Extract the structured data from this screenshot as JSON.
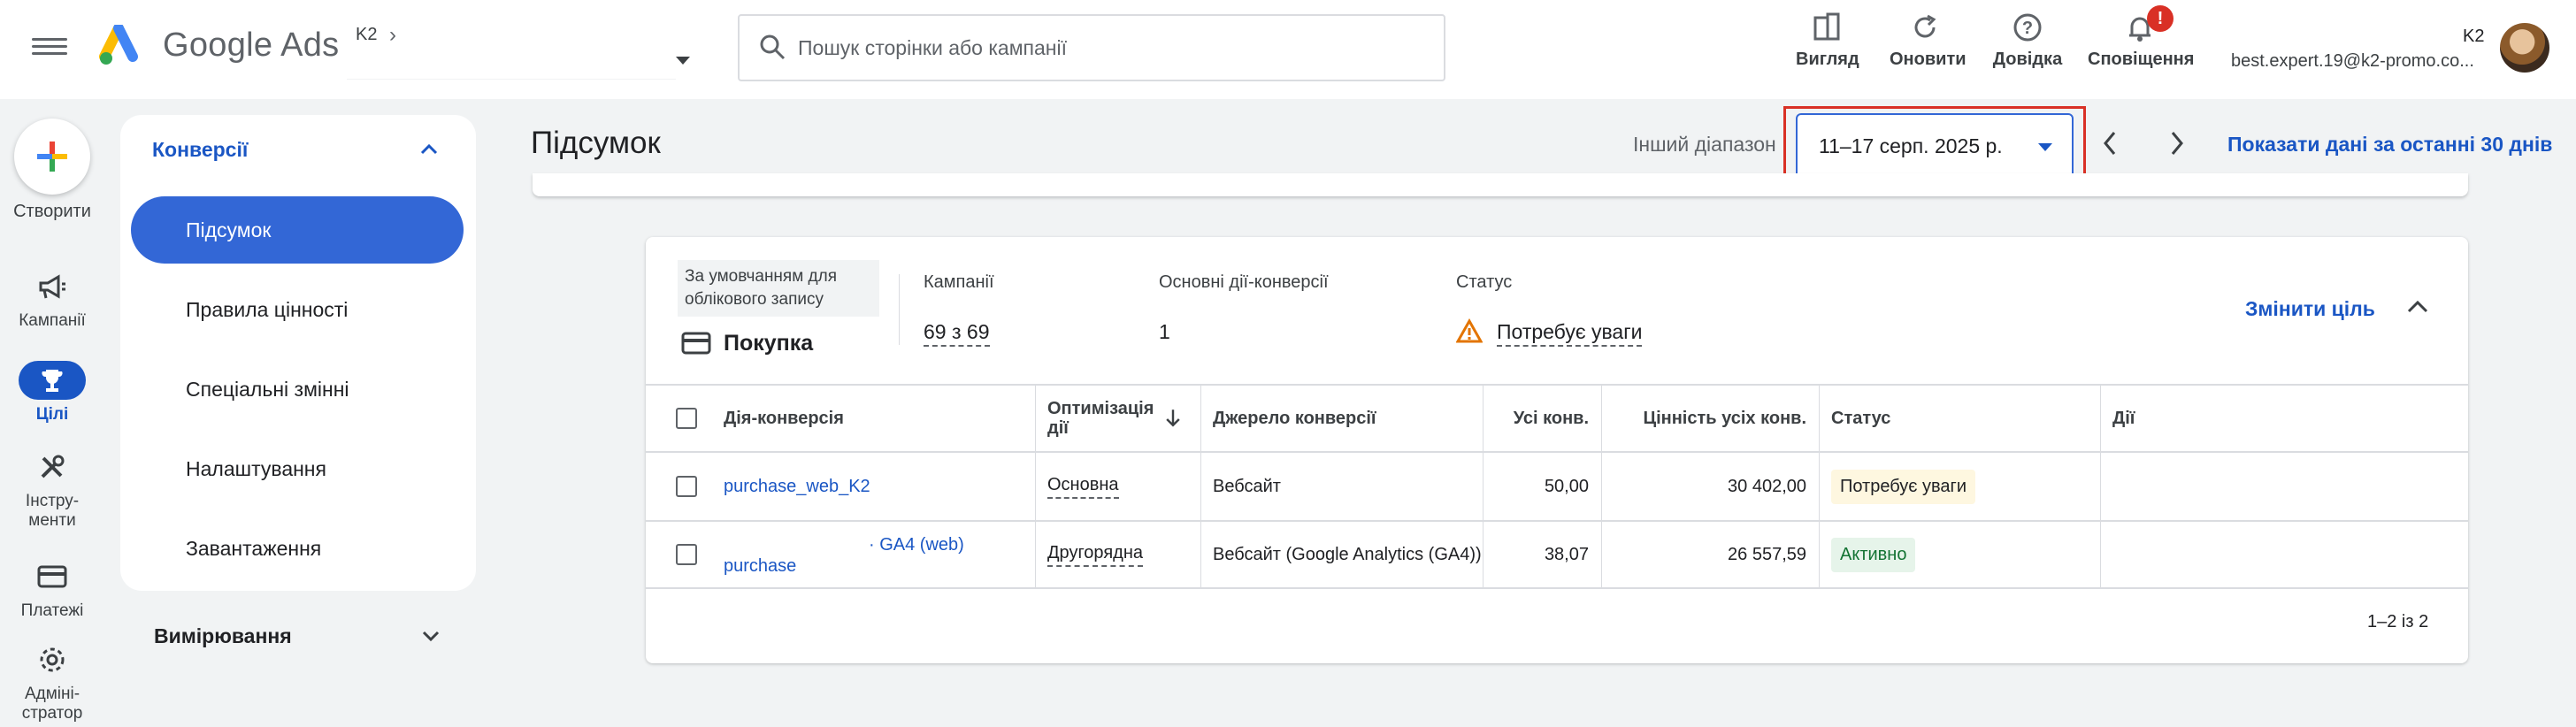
{
  "header": {
    "brand": "Google Ads",
    "account_name": "K2",
    "search_placeholder": "Пошук сторінки або кампанії",
    "buttons": {
      "view": "Вигляд",
      "refresh": "Оновити",
      "help": "Довідка",
      "notifications": "Сповіщення"
    },
    "notification_badge": "!",
    "user_code": "K2",
    "user_email": "best.expert.19@k2-promo.co..."
  },
  "rail": {
    "create": "Створити",
    "items": [
      "Кампанії",
      "Цілі",
      "Інстру-\nменти",
      "Платежі",
      "Адміні-\nстратор"
    ]
  },
  "subnav": {
    "section": "Конверсії",
    "items": [
      "Підсумок",
      "Правила цінності",
      "Спеціальні змінні",
      "Налаштування",
      "Завантаження"
    ],
    "measurement": "Вимірювання"
  },
  "page": {
    "title": "Підсумок",
    "range_label": "Інший діапазон",
    "date_range": "11–17 серп. 2025 р.",
    "last_30": "Показати дані за останні 30 днів"
  },
  "goal_card": {
    "default_note": "За умовчанням для облікового запису",
    "goal_name": "Покупка",
    "campaigns_label": "Кампанії",
    "campaigns_value": "69 з 69",
    "primary_label": "Основні дії-конверсії",
    "primary_value": "1",
    "status_label": "Статус",
    "status_value": "Потребує уваги",
    "change_goal": "Змінити ціль"
  },
  "table": {
    "columns": [
      "Дія-конверсія",
      "Оптимізація дії",
      "Джерело конверсії",
      "Усі конв.",
      "Цінність усіх конв.",
      "Статус",
      "Дії"
    ],
    "rows": [
      {
        "action": "purchase_web_K2",
        "optimization": "Основна",
        "source": "Вебсайт",
        "all_conv": "50,00",
        "value": "30 402,00",
        "status": "Потребує уваги"
      },
      {
        "action": "· GA4 (web)",
        "action_line2": "purchase",
        "optimization": "Другорядна",
        "source": "Вебсайт (Google Analytics (GA4))",
        "all_conv": "38,07",
        "value": "26 557,59",
        "status": "Активно"
      }
    ],
    "pagination": "1–2 із 2"
  },
  "colors": {
    "accent": "#1a56c4",
    "highlight": "#d93025",
    "warn_bg": "#fef7e0",
    "ok_bg": "#e6f4ea"
  }
}
